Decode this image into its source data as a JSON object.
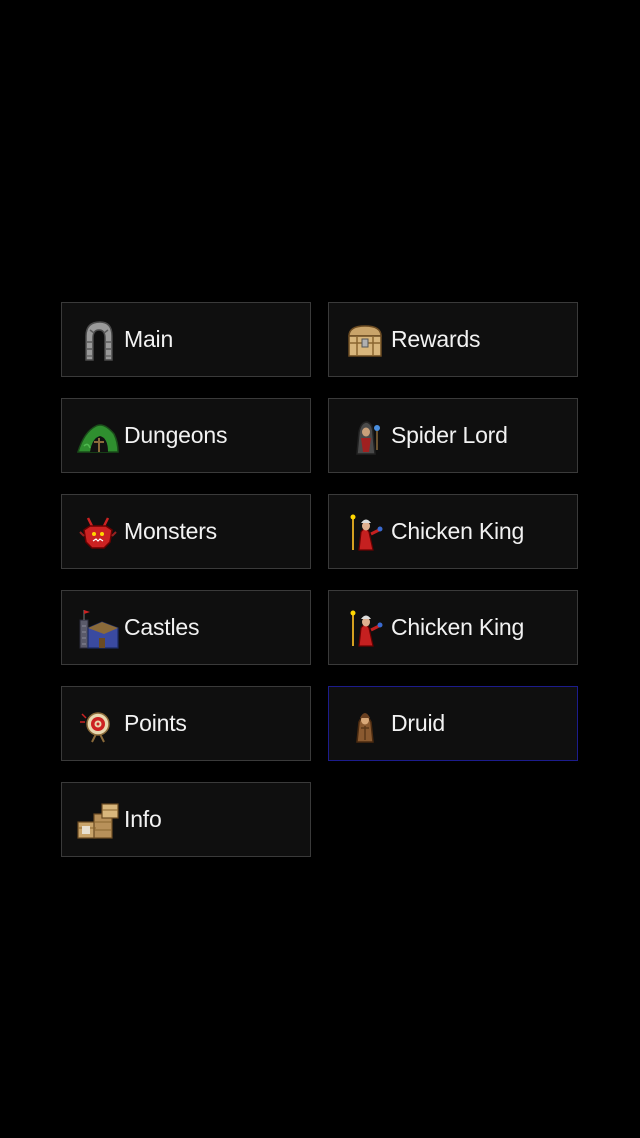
{
  "menu": {
    "items": [
      {
        "label": "Main",
        "icon": "stone-arch-icon"
      },
      {
        "label": "Rewards",
        "icon": "treasure-chest-icon"
      },
      {
        "label": "Dungeons",
        "icon": "cave-entrance-icon"
      },
      {
        "label": "Spider Lord",
        "icon": "hooded-wizard-icon"
      },
      {
        "label": "Monsters",
        "icon": "red-demon-icon"
      },
      {
        "label": "Chicken King",
        "icon": "red-mage-icon"
      },
      {
        "label": "Castles",
        "icon": "castle-icon"
      },
      {
        "label": "Chicken King",
        "icon": "red-mage-icon"
      },
      {
        "label": "Points",
        "icon": "archery-target-icon"
      },
      {
        "label": "Druid",
        "icon": "druid-icon"
      },
      {
        "label": "Info",
        "icon": "crates-icon"
      }
    ],
    "selected_label": "Druid"
  },
  "colors": {
    "background": "#000000",
    "button_fill": "#0f0f0f",
    "button_border": "#3a3a3a",
    "selected_border": "#1c1c8c",
    "text": "#f2f2f2"
  }
}
